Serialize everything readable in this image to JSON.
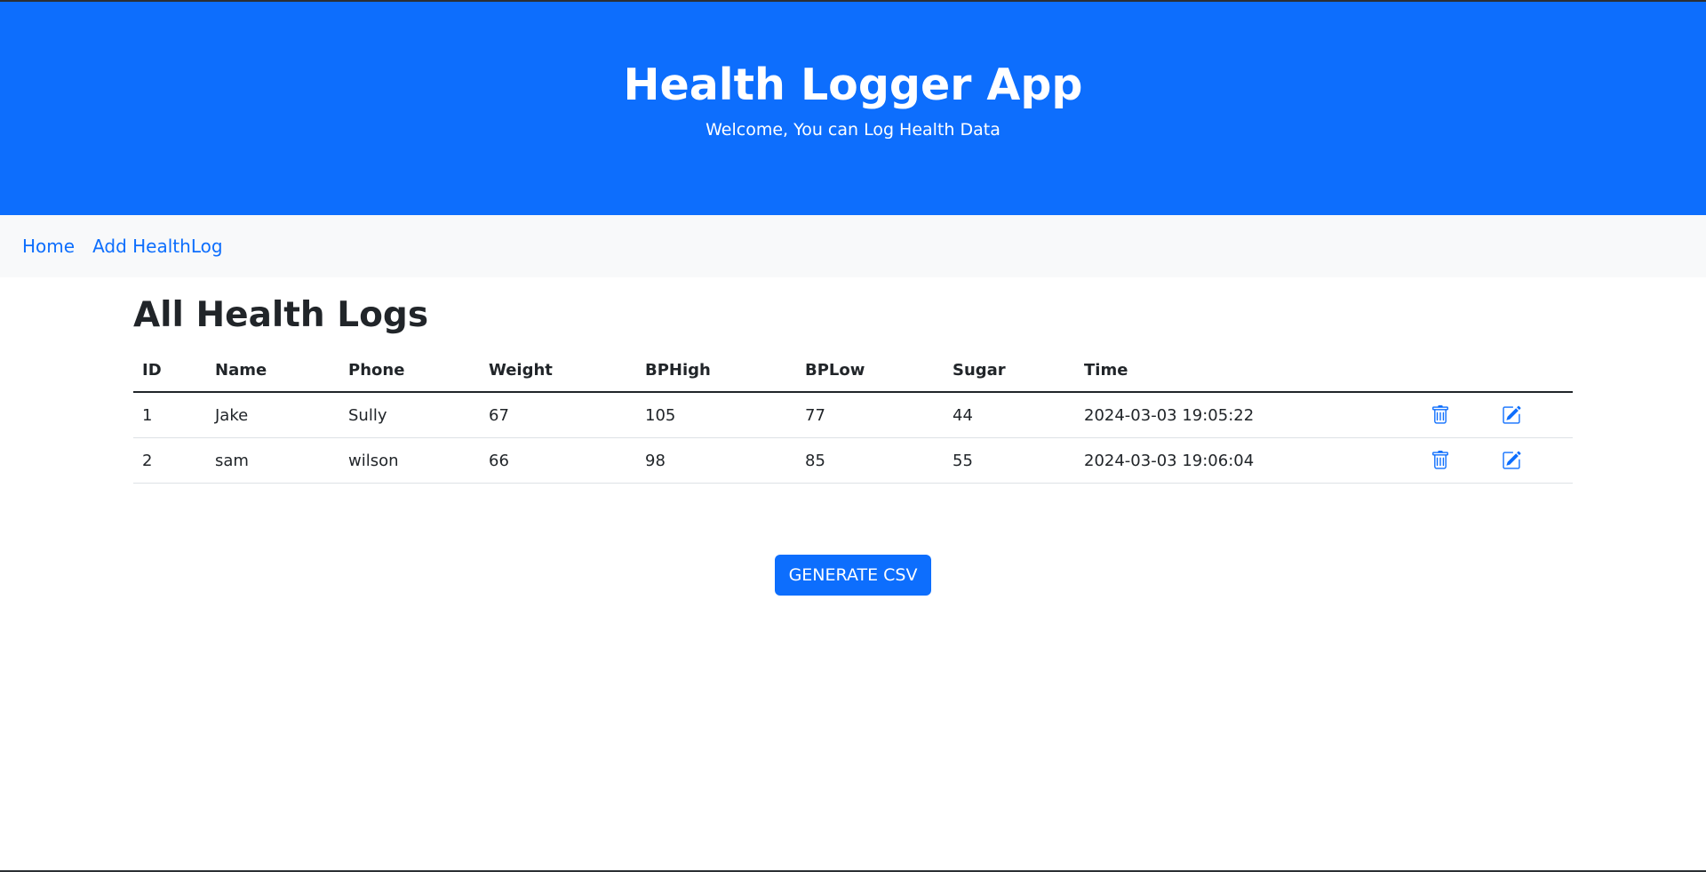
{
  "header": {
    "title": "Health Logger App",
    "subtitle": "Welcome, You can Log Health Data"
  },
  "nav": {
    "home": "Home",
    "add": "Add HealthLog"
  },
  "main": {
    "title": "All Health Logs",
    "columns": [
      "ID",
      "Name",
      "Phone",
      "Weight",
      "BPHigh",
      "BPLow",
      "Sugar",
      "Time"
    ],
    "rows": [
      {
        "id": "1",
        "name": "Jake",
        "phone": "Sully",
        "weight": "67",
        "bphigh": "105",
        "bplow": "77",
        "sugar": "44",
        "time": "2024-03-03 19:05:22",
        "delete_icon": "trash-icon",
        "edit_icon": "edit-icon"
      },
      {
        "id": "2",
        "name": "sam",
        "phone": "wilson",
        "weight": "66",
        "bphigh": "98",
        "bplow": "85",
        "sugar": "55",
        "time": "2024-03-03 19:06:04",
        "delete_icon": "trash-icon",
        "edit_icon": "edit-icon"
      }
    ],
    "csv_button": "GENERATE CSV"
  },
  "colors": {
    "primary": "#0d6efd",
    "navbar_bg": "#f8f9fa",
    "text": "#212529"
  }
}
